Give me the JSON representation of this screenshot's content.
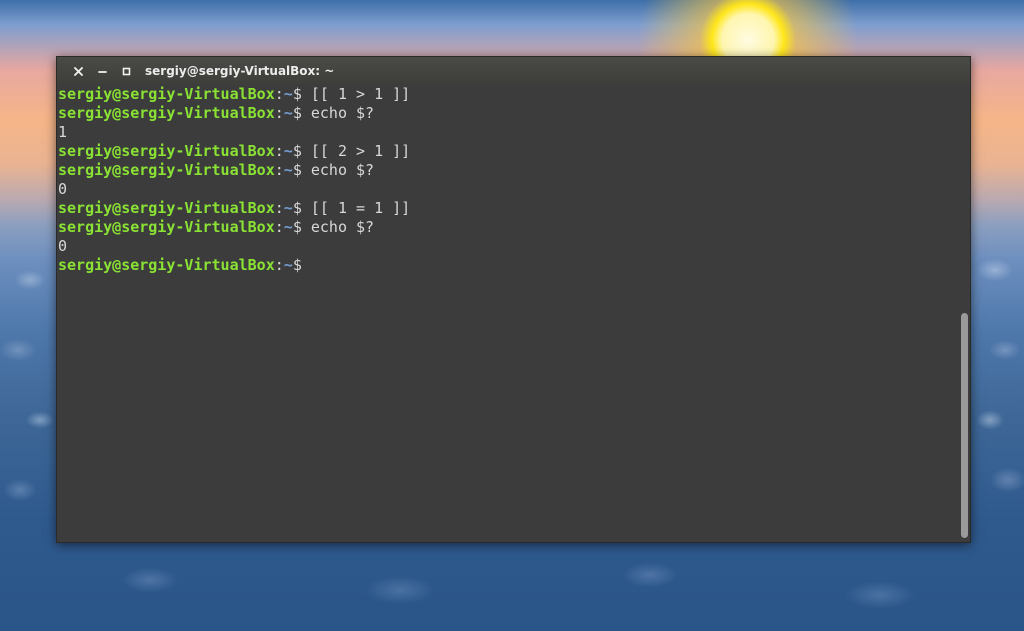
{
  "window": {
    "title": "sergiy@sergiy-VirtualBox: ~"
  },
  "terminal": {
    "lines": [
      {
        "type": "prompt",
        "user": "sergiy@sergiy-VirtualBox",
        "colon": ":",
        "path": "~",
        "symbol": "$ ",
        "command": "[[ 1 > 1 ]]"
      },
      {
        "type": "prompt",
        "user": "sergiy@sergiy-VirtualBox",
        "colon": ":",
        "path": "~",
        "symbol": "$ ",
        "command": "echo $?"
      },
      {
        "type": "output",
        "text": "1"
      },
      {
        "type": "prompt",
        "user": "sergiy@sergiy-VirtualBox",
        "colon": ":",
        "path": "~",
        "symbol": "$ ",
        "command": "[[ 2 > 1 ]]"
      },
      {
        "type": "prompt",
        "user": "sergiy@sergiy-VirtualBox",
        "colon": ":",
        "path": "~",
        "symbol": "$ ",
        "command": "echo $?"
      },
      {
        "type": "output",
        "text": "0"
      },
      {
        "type": "prompt",
        "user": "sergiy@sergiy-VirtualBox",
        "colon": ":",
        "path": "~",
        "symbol": "$ ",
        "command": "[[ 1 = 1 ]]"
      },
      {
        "type": "prompt",
        "user": "sergiy@sergiy-VirtualBox",
        "colon": ":",
        "path": "~",
        "symbol": "$ ",
        "command": "echo $?"
      },
      {
        "type": "output",
        "text": "0"
      },
      {
        "type": "prompt",
        "user": "sergiy@sergiy-VirtualBox",
        "colon": ":",
        "path": "~",
        "symbol": "$",
        "command": ""
      }
    ]
  },
  "colors": {
    "user": "#8ae234",
    "path": "#729fcf",
    "text": "#d8d8d8",
    "background": "#3c3c3c"
  },
  "icons": {
    "close": "close-icon",
    "minimize": "minimize-icon",
    "maximize": "maximize-icon"
  }
}
